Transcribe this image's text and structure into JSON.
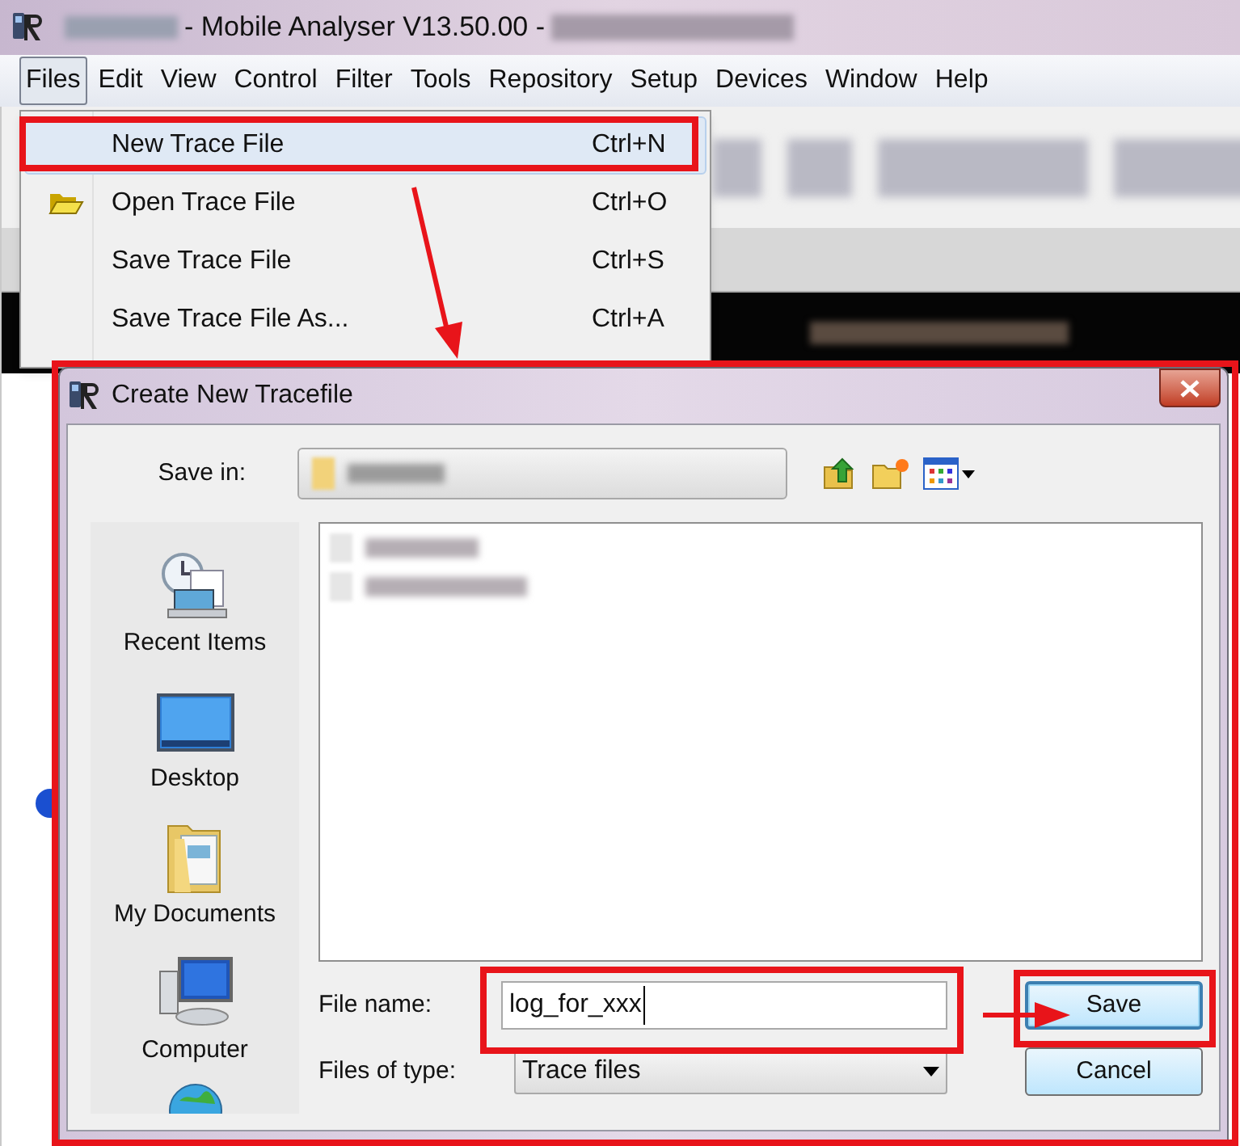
{
  "window": {
    "title": "- Mobile Analyser V13.50.00 -"
  },
  "menu_bar": [
    {
      "label": "Files",
      "selected": true
    },
    {
      "label": "Edit",
      "selected": false
    },
    {
      "label": "View",
      "selected": false
    },
    {
      "label": "Control",
      "selected": false
    },
    {
      "label": "Filter",
      "selected": false
    },
    {
      "label": "Tools",
      "selected": false
    },
    {
      "label": "Repository",
      "selected": false
    },
    {
      "label": "Setup",
      "selected": false
    },
    {
      "label": "Devices",
      "selected": false
    },
    {
      "label": "Window",
      "selected": false
    },
    {
      "label": "Help",
      "selected": false
    }
  ],
  "files_menu": [
    {
      "label": "New Trace File",
      "shortcut": "Ctrl+N",
      "selected": true,
      "kind": "plain"
    },
    {
      "label": "Open Trace File",
      "shortcut": "Ctrl+O",
      "selected": false,
      "kind": "folder"
    },
    {
      "label": "Save Trace File",
      "shortcut": "Ctrl+S",
      "selected": false,
      "kind": "plain"
    },
    {
      "label": "Save Trace File As...",
      "shortcut": "Ctrl+A",
      "selected": false,
      "kind": "plain"
    }
  ],
  "dialog": {
    "title": "Create New Tracefile",
    "save_in_label": "Save in:",
    "places": [
      {
        "label": "Recent Items",
        "kind": "recent"
      },
      {
        "label": "Desktop",
        "kind": "desktop"
      },
      {
        "label": "My Documents",
        "kind": "documents"
      },
      {
        "label": "Computer",
        "kind": "computer"
      }
    ],
    "file_name": {
      "label": "File name:",
      "value": "log_for_xxx"
    },
    "file_type": {
      "label": "Files of type:",
      "value": "Trace files"
    },
    "buttons": [
      {
        "label": "Save",
        "kind": "primary"
      },
      {
        "label": "Cancel",
        "kind": "secondary"
      }
    ]
  }
}
